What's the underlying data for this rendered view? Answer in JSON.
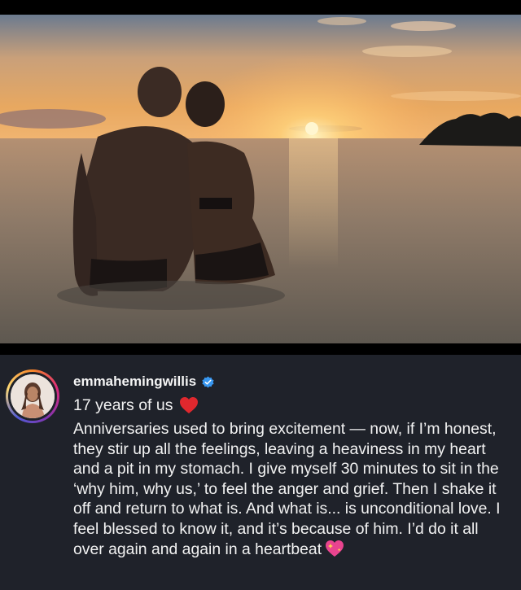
{
  "post": {
    "username": "emmahemingwillis",
    "verified": true,
    "headline": "17 years of us",
    "headline_emoji": "red-heart",
    "body": "Anniversaries used to bring excitement — now, if I’m honest, they stir up all the feelings, leaving a heaviness in my heart and a pit in my stomach. I give myself 30 minutes to sit in the ‘why him, why us,’ to feel the anger and grief. Then I shake it off and return to what is. And what is... is unconditional love. I feel blessed to know it, and it’s because of him. I’d do it all over again and again in a heartbeat",
    "body_emoji": "sparkling-heart"
  },
  "icons": {
    "verified": "verified-badge-icon",
    "heart": "red-heart-icon",
    "sparkle_heart": "sparkling-heart-icon"
  },
  "colors": {
    "background": "#1f222a",
    "text": "#f2f2f2",
    "verified_blue": "#3897f0",
    "heart_red": "#e0282e",
    "sparkle_pink": "#e9448f"
  }
}
